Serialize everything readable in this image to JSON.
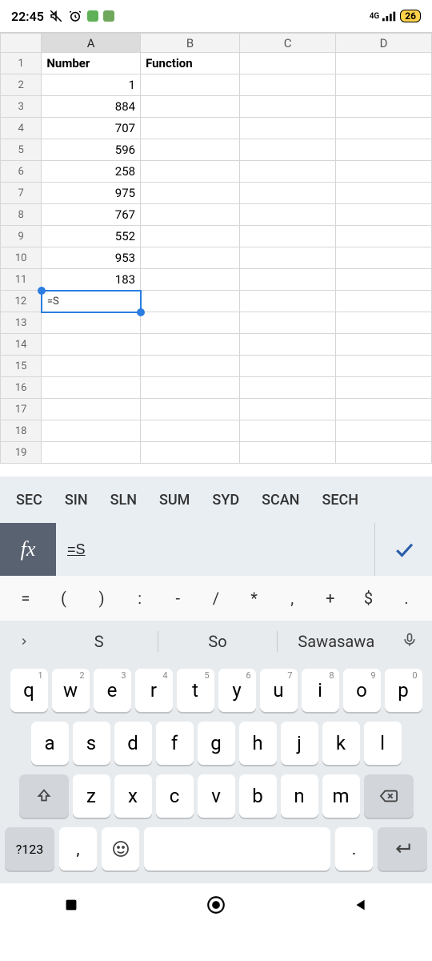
{
  "status": {
    "time": "22:45",
    "network_label": "4G",
    "battery": "26"
  },
  "sheet": {
    "columns": [
      "A",
      "B",
      "C",
      "D"
    ],
    "selected_col_index": 0,
    "rows": [
      1,
      2,
      3,
      4,
      5,
      6,
      7,
      8,
      9,
      10,
      11,
      12,
      13,
      14,
      15,
      16,
      17,
      18,
      19
    ],
    "active_cell": {
      "row": 12,
      "col": "A",
      "display": "=S"
    },
    "data": {
      "A1": "Number",
      "B1": "Function",
      "A2": "1",
      "A3": "884",
      "A4": "707",
      "A5": "596",
      "A6": "258",
      "A7": "975",
      "A8": "767",
      "A9": "552",
      "A10": "953",
      "A11": "183"
    }
  },
  "function_suggestions": [
    "SEC",
    "SIN",
    "SLN",
    "SUM",
    "SYD",
    "SCAN",
    "SECH"
  ],
  "formula_bar": {
    "fx_label": "fx",
    "value": "=S"
  },
  "symbol_row": [
    "=",
    "(",
    ")",
    ":",
    "-",
    "/",
    "*",
    ",",
    "+",
    "$",
    "."
  ],
  "predictions": {
    "items": [
      "S",
      "So",
      "Sawasawa"
    ]
  },
  "keyboard": {
    "row1": [
      {
        "k": "q",
        "n": "1"
      },
      {
        "k": "w",
        "n": "2"
      },
      {
        "k": "e",
        "n": "3"
      },
      {
        "k": "r",
        "n": "4"
      },
      {
        "k": "t",
        "n": "5"
      },
      {
        "k": "y",
        "n": "6"
      },
      {
        "k": "u",
        "n": "7"
      },
      {
        "k": "i",
        "n": "8"
      },
      {
        "k": "o",
        "n": "9"
      },
      {
        "k": "p",
        "n": "0"
      }
    ],
    "row2": [
      "a",
      "s",
      "d",
      "f",
      "g",
      "h",
      "j",
      "k",
      "l"
    ],
    "row3": [
      "z",
      "x",
      "c",
      "v",
      "b",
      "n",
      "m"
    ],
    "mode_key": "?123",
    "comma": ",",
    "period": "."
  }
}
